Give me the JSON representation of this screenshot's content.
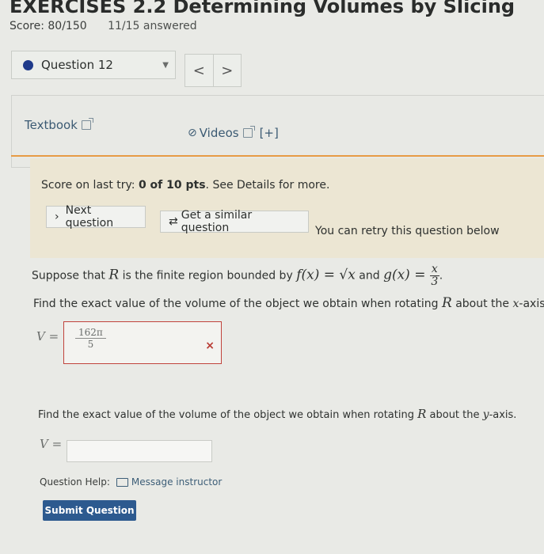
{
  "header": {
    "title": "EXERCISES 2.2 Determining Volumes by Slicing",
    "score": "Score: 80/150",
    "answered": "11/15 answered"
  },
  "question_nav": {
    "selected": "Question 12",
    "prev": "<",
    "next": ">"
  },
  "help": {
    "textbook": "Textbook",
    "videos": "Videos",
    "expand": "[+]"
  },
  "score_box": {
    "prefix": "Score on last try: ",
    "score": "0 of 10 pts",
    "suffix": ". See Details for more.",
    "next_question": "Next question",
    "similar_question": "Get a similar question",
    "retry_text": "You can retry this question below"
  },
  "question": {
    "part1_text_a": "Suppose that ",
    "region": "R",
    "part1_text_b": " is the finite region bounded by ",
    "f_def": "f(x) = √x",
    "and": " and ",
    "g_lhs": "g(x) = ",
    "g_num": "x",
    "g_den": "3",
    "period": ".",
    "prompt1_a": "Find the exact value of the volume of the object we obtain when rotating ",
    "prompt1_b": " about the ",
    "axis1": "x",
    "prompt1_c": "-axis.",
    "answer1_num": "162π",
    "answer1_den": "5",
    "wrong_mark": "×",
    "prompt2_a": "Find the exact value of the volume of the object we obtain when rotating ",
    "prompt2_b": " about the ",
    "axis2": "y",
    "prompt2_c": "-axis.",
    "v_label": "V ="
  },
  "footer": {
    "help_label": "Question Help:",
    "message": "Message instructor",
    "submit": "Submit Question"
  }
}
